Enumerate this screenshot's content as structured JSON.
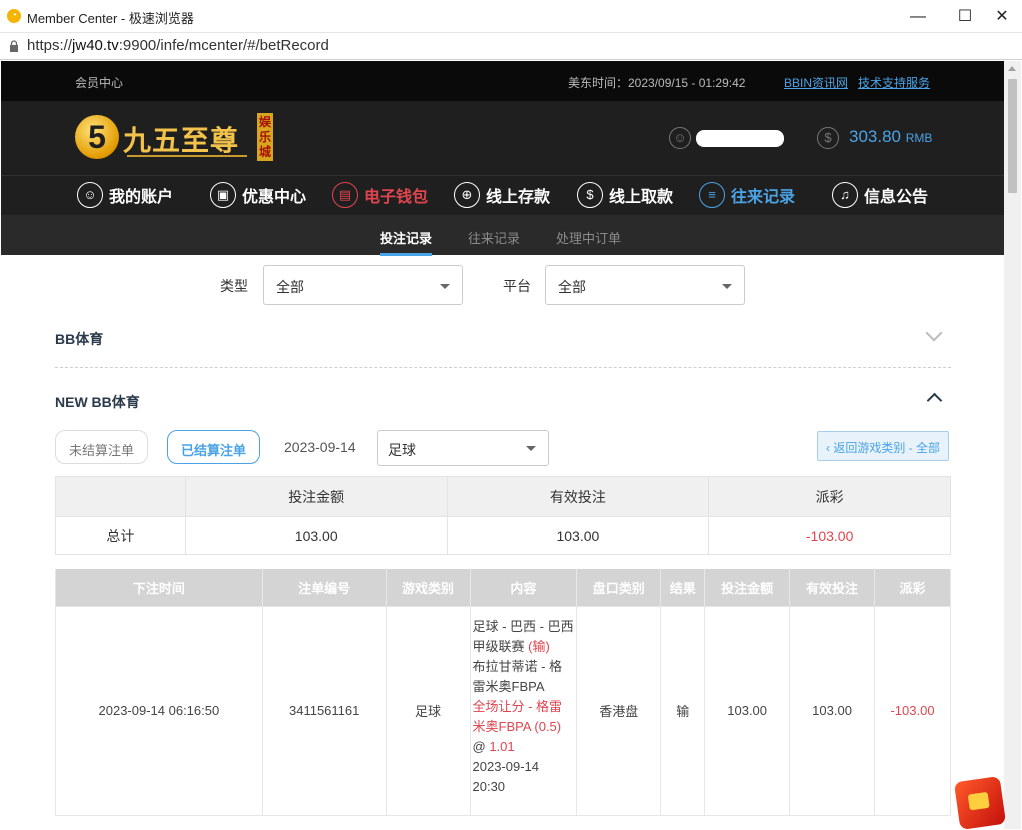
{
  "browser": {
    "title": "Member Center - 极速浏览器",
    "url_prefix": "https://",
    "url_host": "jw40.tv",
    "url_rest": ":9900/infe/mcenter/#/betRecord",
    "minimize": "—",
    "maximize": "☐",
    "close": "✕"
  },
  "topbar": {
    "member_center": "会员中心",
    "time": "美东时间：2023/09/15 - 01:29:42",
    "link_news": "BBIN资讯网",
    "link_support": "技术支持服务"
  },
  "logo": {
    "digit": "5",
    "name": "九五至尊",
    "sub": "娱乐城"
  },
  "account": {
    "balance": "303.80",
    "currency": "RMB"
  },
  "main_nav": [
    {
      "label": "我的账户",
      "icon": "user-icon",
      "glyph": "☺"
    },
    {
      "label": "优惠中心",
      "icon": "gift-icon",
      "glyph": "▣"
    },
    {
      "label": "电子钱包",
      "icon": "wallet-icon",
      "glyph": "▤"
    },
    {
      "label": "线上存款",
      "icon": "deposit-icon",
      "glyph": "⊕"
    },
    {
      "label": "线上取款",
      "icon": "withdraw-icon",
      "glyph": "$"
    },
    {
      "label": "往来记录",
      "icon": "record-icon",
      "glyph": "≡"
    },
    {
      "label": "信息公告",
      "icon": "bell-icon",
      "glyph": "♫"
    }
  ],
  "sub_nav": [
    "投注记录",
    "往来记录",
    "处理中订单"
  ],
  "filters": {
    "type_label": "类型",
    "type_value": "全部",
    "platform_label": "平台",
    "platform_value": "全部"
  },
  "sections": {
    "bb_sports": "BB体育",
    "new_bb_sports": "NEW BB体育"
  },
  "controls": {
    "unsettled": "未结算注单",
    "settled": "已结算注单",
    "date": "2023-09-14",
    "sport_value": "足球",
    "back": "‹ 返回游戏类别 - 全部"
  },
  "summary": {
    "headers": [
      "投注金额",
      "有效投注",
      "派彩"
    ],
    "row_label": "总计",
    "values": [
      "103.00",
      "103.00",
      "-103.00"
    ]
  },
  "records": {
    "headers": [
      "下注时间",
      "注单编号",
      "游戏类别",
      "内容",
      "盘口类别",
      "结果",
      "投注金额",
      "有效投注",
      "派彩"
    ],
    "rows": [
      {
        "time": "2023-09-14 06:16:50",
        "bet_id": "3411561161",
        "game": "足球",
        "content_1": "足球 - 巴西 - 巴西甲级联赛 ",
        "content_1_red": "(输)",
        "content_2": "布拉甘蒂诺 - 格雷米奥FBPA",
        "content_3_red": "全场让分 - 格雷米奥FBPA (0.5)",
        "content_4": "@ ",
        "content_4_red": "1.01",
        "content_5": "2023-09-14 20:30",
        "market": "香港盘",
        "result": "输",
        "stake": "103.00",
        "valid": "103.00",
        "payout": "-103.00"
      }
    ]
  },
  "colors": {
    "accent": "#4aa3e6",
    "negative": "#e0454f",
    "header_bg": "#1f1f1f"
  }
}
